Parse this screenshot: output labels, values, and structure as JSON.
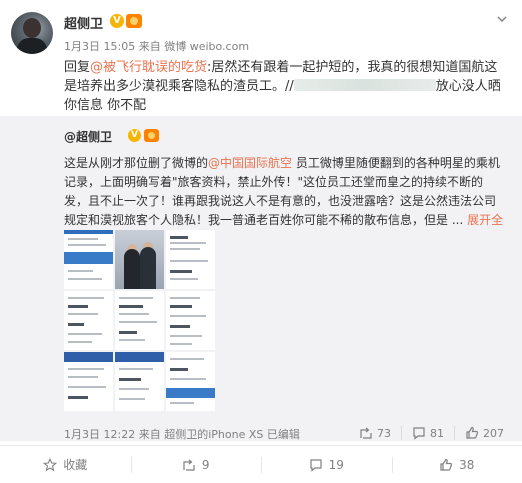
{
  "post": {
    "username": "超侧卫",
    "v_badge": "V",
    "time": "1月3日 15:05",
    "source_prefix": "来自",
    "source": "微博 weibo.com",
    "reply_prefix": "回复",
    "reply_mention": "@被飞行耽误的吃货",
    "text_part1": ":居然还有跟着一起护短的，我真的很想知道国航这是培养出多少漠视乘客隐私的渣员工。//",
    "text_part2": "放心没人晒你信息 你不配"
  },
  "repost": {
    "username": "@超侧卫",
    "v_badge": "V",
    "text_part1": "这是从刚才那位删了微博的",
    "mention": "@中国国际航空",
    "text_part2": " 员工微博里随便翻到的各种明星的乘机记录，上面明确写着\"旅客资料，禁止外传！\"这位员工还堂而皇之的持续不断的发，且不止一次了！谁再跟我说这人不是有意的，也没泄露啥？这是公然违法公司规定和漠视旅客个人隐私！我一普通老百姓你可能不稀的散布信息，但是 ... ",
    "more": "展开全文",
    "more_arrow": "⌄",
    "time": "1月3日 12:22",
    "source_prefix": "来自",
    "source": "超侧卫的iPhone XS",
    "edited": "已编辑",
    "stats": {
      "reposts": "73",
      "comments": "81",
      "likes": "207"
    }
  },
  "actions": {
    "favorite": "收藏",
    "repost": "9",
    "comment": "19",
    "like": "38"
  }
}
